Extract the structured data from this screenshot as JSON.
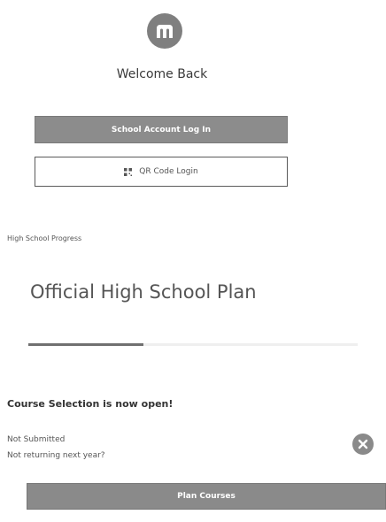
{
  "header": {
    "logo_icon": "logo-icon",
    "welcome_text": "Welcome Back"
  },
  "login": {
    "school_button_label": "School Account Log In",
    "qr_button_label": "QR Code Login",
    "qr_icon": "qr-code-icon"
  },
  "progress": {
    "section_label": "High School Progress",
    "plan_title": "Official High School Plan",
    "plan_subtitle": "",
    "fraction": 0.35
  },
  "course_selection": {
    "heading": "Course Selection is now open!",
    "status": "Not Submitted",
    "returning_prompt": "Not returning next year?",
    "dismiss_icon": "close-icon",
    "plan_button_label": "Plan Courses"
  },
  "colors": {
    "accent": "#8a8a8a",
    "text": "#333333"
  }
}
